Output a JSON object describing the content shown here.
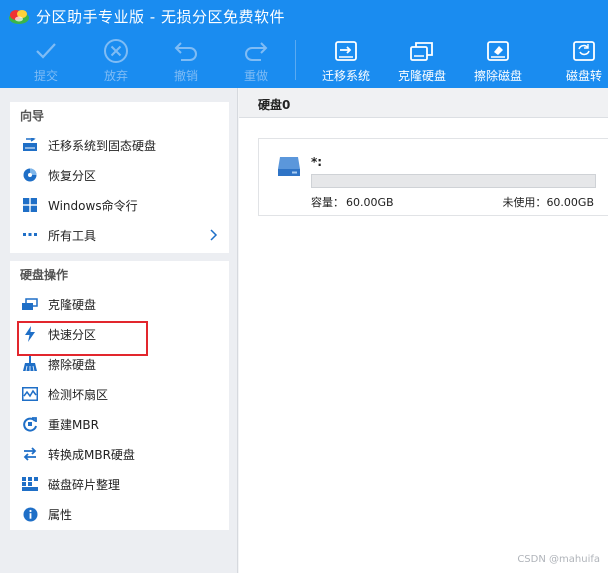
{
  "window": {
    "title": "分区助手专业版 - 无损分区免费软件"
  },
  "toolbar": {
    "commit": "提交",
    "discard": "放弃",
    "undo": "撤销",
    "redo": "重做",
    "migrate_os": "迁移系统",
    "clone_disk": "克隆硬盘",
    "wipe_disk": "擦除磁盘",
    "disk_convert_partial": "磁盘转"
  },
  "guide": {
    "title": "向导",
    "items": [
      "迁移系统到固态硬盘",
      "恢复分区",
      "Windows命令行",
      "所有工具"
    ]
  },
  "disk_ops": {
    "title": "硬盘操作",
    "items": [
      "克隆硬盘",
      "快速分区",
      "擦除硬盘",
      "检测坏扇区",
      "重建MBR",
      "转换成MBR硬盘",
      "磁盘碎片整理",
      "属性"
    ]
  },
  "disk": {
    "header": "硬盘0",
    "name": "*:",
    "capacity_label": "容量：",
    "capacity": "60.00GB",
    "unused_label": "未使用：",
    "unused": "60.00GB"
  },
  "watermark": "CSDN @mahuifa",
  "colors": {
    "accent": "#1a8cf0",
    "highlight": "#e2262d",
    "icon_blue": "#1f6fc7"
  },
  "icons": {
    "toolbar": [
      "check-icon",
      "cancel-circle-icon",
      "undo-icon",
      "redo-icon",
      "migrate-drive-icon",
      "clone-drive-icon",
      "wipe-drive-icon",
      "refresh-drive-icon"
    ],
    "guide": [
      "ssd-migrate-icon",
      "pie-restore-icon",
      "windows-icon",
      "dots-icon"
    ],
    "disk_ops": [
      "clone-icon",
      "lightning-icon",
      "broom-icon",
      "scan-icon",
      "rebuild-icon",
      "convert-icon",
      "defrag-icon",
      "info-icon"
    ]
  }
}
